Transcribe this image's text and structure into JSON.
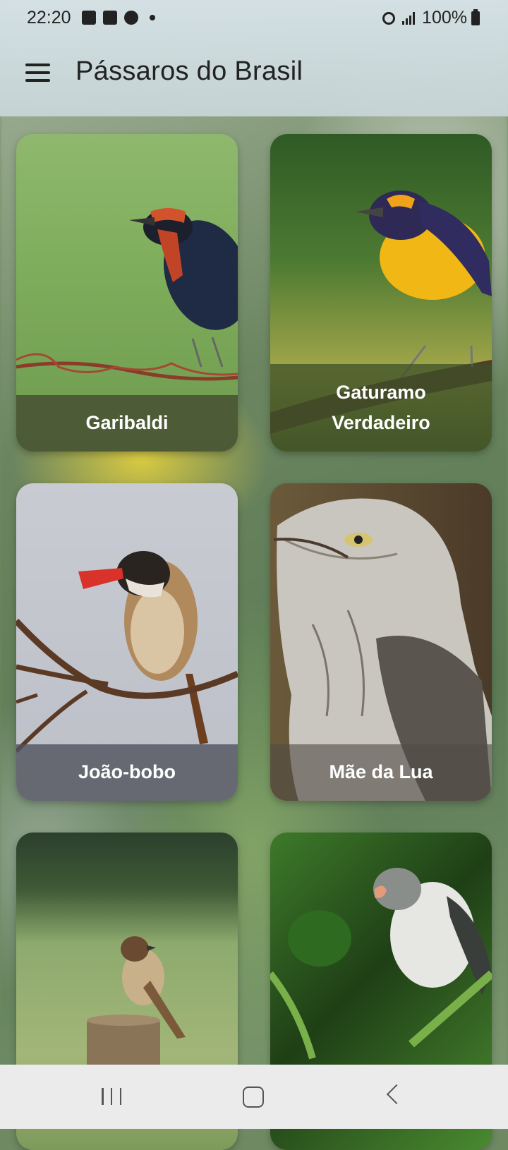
{
  "status_bar": {
    "time": "22:20",
    "battery": "100%",
    "icons": [
      "gallery-icon",
      "checkbox-icon",
      "a-circle-icon",
      "dot-icon",
      "alarm-icon",
      "signal-icon",
      "battery-icon"
    ]
  },
  "app_bar": {
    "title": "Pássaros do Brasil",
    "menu_icon": "hamburger-menu-icon"
  },
  "birds": [
    {
      "name": "Garibaldi"
    },
    {
      "name": "Gaturamo\nVerdadeiro"
    },
    {
      "name": "João-bobo"
    },
    {
      "name": "Mãe da Lua"
    },
    {
      "name": ""
    },
    {
      "name": ""
    }
  ],
  "nav_bar": {
    "icons": [
      "recent-apps-icon",
      "home-icon",
      "back-icon"
    ]
  }
}
